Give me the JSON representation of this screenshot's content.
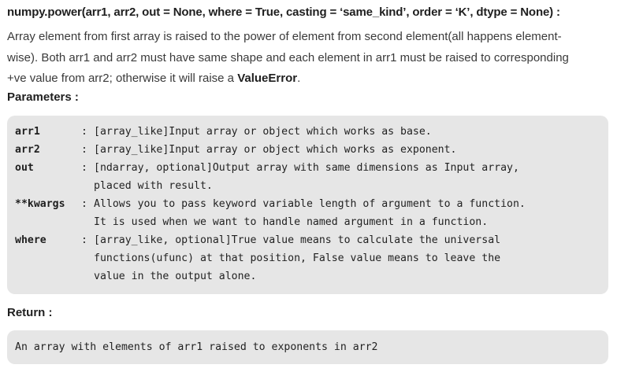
{
  "signature": "numpy.power(arr1, arr2, out = None, where = True, casting = ‘same_kind’, order = ‘K’, dtype = None) :",
  "description": {
    "line1": "Array element from first array is raised to the power of element from second element(all happens element-",
    "line2": "wise). Both arr1 and arr2 must have same shape and each element in arr1 must be raised to corresponding",
    "line3_prefix": "+ve value from arr2; otherwise it will raise a ",
    "line3_bold": "ValueError",
    "line3_suffix": "."
  },
  "parameters_heading": "Parameters :",
  "parameters": {
    "arr1": {
      "name": "arr1",
      "colon": ":",
      "text1": "[array_like]Input array or object which works as base."
    },
    "arr2": {
      "name": "arr2",
      "colon": ":",
      "text1": "[array_like]Input array or object which works as exponent."
    },
    "out": {
      "name": "out",
      "colon": ":",
      "text1": "[ndarray, optional]Output array with same dimensions as Input array,",
      "text2": "placed with result."
    },
    "kwargs": {
      "name": "**kwargs",
      "colon": ":",
      "text1": "Allows you to pass keyword variable length of argument to a function.",
      "text2": "It is used when we want to handle named argument in a function."
    },
    "where": {
      "name": "where",
      "colon": ":",
      "text1": "[array_like, optional]True value means to calculate the universal",
      "text2": "functions(ufunc) at that position, False value means to leave the",
      "text3": "value in the output alone."
    }
  },
  "return_heading": "Return :",
  "return_text": "An array with elements of arr1 raised to exponents in arr2"
}
